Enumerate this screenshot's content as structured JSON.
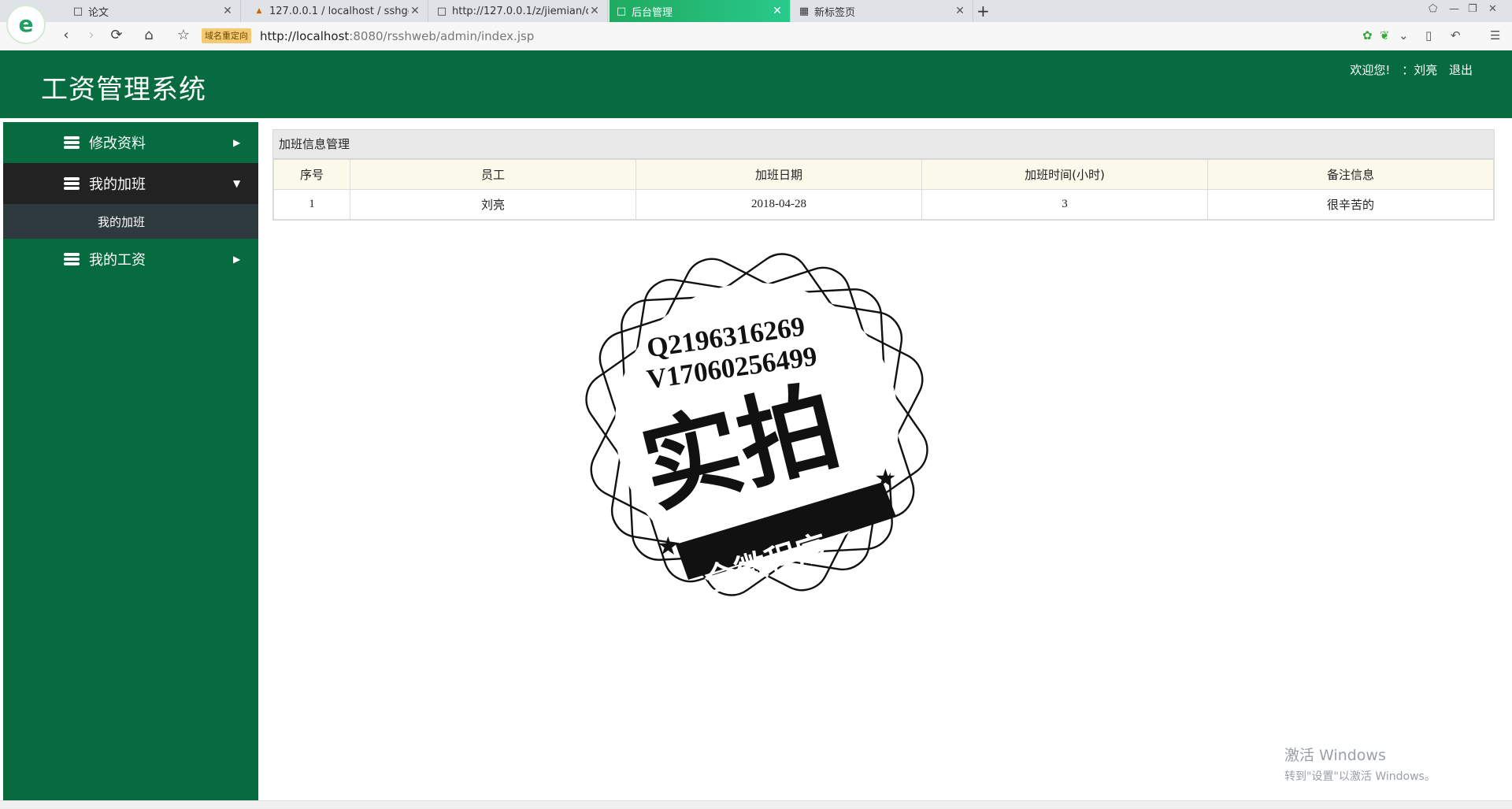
{
  "browser": {
    "tabs": [
      {
        "title": "论文",
        "active": false
      },
      {
        "title": "127.0.0.1 / localhost / sshgongzi",
        "active": false
      },
      {
        "title": "http://127.0.0.1/z/jiemian/create",
        "active": false
      },
      {
        "title": "后台管理",
        "active": true
      },
      {
        "title": "新标签页",
        "active": false
      }
    ],
    "redirect_badge": "域名重定向",
    "url_host": "http://localhost",
    "url_path": ":8080/rsshweb/admin/index.jsp",
    "active_tab_color": "#1faa5f"
  },
  "header": {
    "title": "工资管理系统",
    "welcome": "欢迎您!",
    "user": "：刘亮",
    "logout": "退出",
    "bg_color": "#066b3e"
  },
  "sidebar": {
    "items": [
      {
        "label": "修改资料",
        "expanded": false
      },
      {
        "label": "我的加班",
        "expanded": true,
        "children": [
          {
            "label": "我的加班"
          }
        ]
      },
      {
        "label": "我的工资",
        "expanded": false
      }
    ]
  },
  "main": {
    "panel_title": "加班信息管理",
    "table": {
      "headers": [
        "序号",
        "员工",
        "加班日期",
        "加班时间(小时)",
        "备注信息"
      ],
      "rows": [
        [
          "1",
          "刘亮",
          "2018-04-28",
          "3",
          "很辛苦的"
        ]
      ]
    }
  },
  "watermark": {
    "line1": "Q2196316269",
    "line2": "V17060256499",
    "big_text": "实拍",
    "banner": "全微程序"
  },
  "activation": {
    "line1": "激活 Windows",
    "line2": "转到\"设置\"以激活 Windows。"
  }
}
